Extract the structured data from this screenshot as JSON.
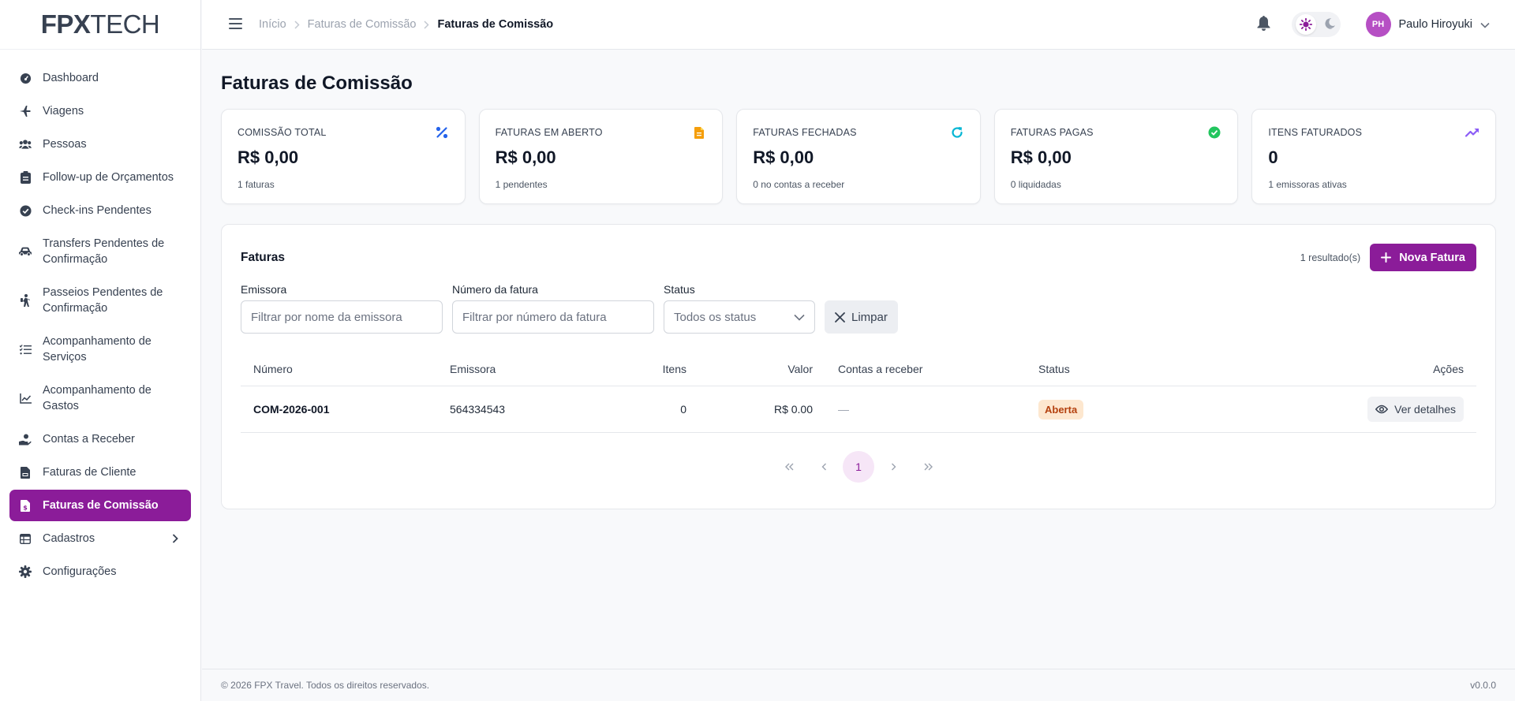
{
  "brand": {
    "logo_bold": "FPX",
    "logo_thin": "TECH"
  },
  "sidebar": {
    "items": [
      {
        "label": "Dashboard",
        "icon": "gauge-icon"
      },
      {
        "label": "Viagens",
        "icon": "plane-icon"
      },
      {
        "label": "Pessoas",
        "icon": "users-icon"
      },
      {
        "label": "Follow-up de Orçamentos",
        "icon": "clipboard-icon"
      },
      {
        "label": "Check-ins Pendentes",
        "icon": "check-circle-icon"
      },
      {
        "label": "Transfers Pendentes de Confirmação",
        "icon": "car-icon"
      },
      {
        "label": "Passeios Pendentes de Confirmação",
        "icon": "hiking-icon"
      },
      {
        "label": "Acompanhamento de Serviços",
        "icon": "list-check-icon"
      },
      {
        "label": "Acompanhamento de Gastos",
        "icon": "chart-line-icon"
      },
      {
        "label": "Contas a Receber",
        "icon": "hand-coin-icon"
      },
      {
        "label": "Faturas de Cliente",
        "icon": "file-invoice-icon"
      },
      {
        "label": "Faturas de Comissão",
        "icon": "file-invoice-dollar-icon",
        "active": true
      },
      {
        "label": "Cadastros",
        "icon": "table-icon"
      },
      {
        "label": "Configurações",
        "icon": "gear-icon"
      }
    ]
  },
  "header": {
    "breadcrumb": [
      "Início",
      "Faturas de Comissão",
      "Faturas de Comissão"
    ],
    "user": {
      "initials": "PH",
      "name": "Paulo Hiroyuki"
    }
  },
  "page": {
    "title": "Faturas de Comissão"
  },
  "stats": [
    {
      "label": "COMISSÃO TOTAL",
      "value": "R$ 0,00",
      "sub": "1 faturas",
      "icon": "percent-icon",
      "color": "#2563eb"
    },
    {
      "label": "FATURAS EM ABERTO",
      "value": "R$ 0,00",
      "sub": "1 pendentes",
      "icon": "file-icon",
      "color": "#f59e0b"
    },
    {
      "label": "FATURAS FECHADAS",
      "value": "R$ 0,00",
      "sub": "0 no contas a receber",
      "icon": "refresh-icon",
      "color": "#06b6d4"
    },
    {
      "label": "FATURAS PAGAS",
      "value": "R$ 0,00",
      "sub": "0 liquidadas",
      "icon": "check-circle-icon",
      "color": "#22c55e"
    },
    {
      "label": "ITENS FATURADOS",
      "value": "0",
      "sub": "1 emissoras ativas",
      "icon": "trend-up-icon",
      "color": "#8b5cf6"
    }
  ],
  "panel": {
    "title": "Faturas",
    "result_count": "1 resultado(s)",
    "new_button": "Nova Fatura",
    "filters": {
      "emissora_label": "Emissora",
      "emissora_placeholder": "Filtrar por nome da emissora",
      "numero_label": "Número da fatura",
      "numero_placeholder": "Filtrar por número da fatura",
      "status_label": "Status",
      "status_value": "Todos os status",
      "clear_button": "Limpar"
    },
    "columns": {
      "numero": "Número",
      "emissora": "Emissora",
      "itens": "Itens",
      "valor": "Valor",
      "contas": "Contas a receber",
      "status": "Status",
      "acoes": "Ações"
    },
    "rows": [
      {
        "numero": "COM-2026-001",
        "emissora": "564334543",
        "itens": "0",
        "valor": "R$ 0.00",
        "contas": "—",
        "status": "Aberta",
        "action": "Ver detalhes"
      }
    ],
    "pagination": {
      "current": "1",
      "first": "«",
      "prev": "‹",
      "next": "›",
      "last": "»"
    }
  },
  "footer": {
    "copyright": "© 2026 FPX Travel. Todos os direitos reservados.",
    "version": "v0.0.0"
  },
  "colors": {
    "accent": "#8b1c99",
    "badge_bg": "#fde7cf",
    "badge_text": "#b4410f"
  }
}
